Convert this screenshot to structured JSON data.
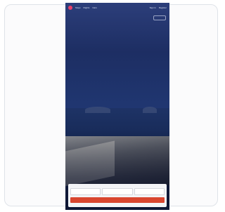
{
  "nav": {
    "links": [
      "Stays",
      "Flights",
      "Cars"
    ],
    "right": [
      "Sign in",
      "Register"
    ]
  },
  "hero": {
    "headline": "",
    "subline": ""
  },
  "search": {
    "title": "",
    "fields": [
      {
        "label": "",
        "value": ""
      },
      {
        "label": "",
        "value": ""
      },
      {
        "label": "",
        "value": ""
      }
    ],
    "cta_label": ""
  },
  "colors": {
    "brand": "#e8416a",
    "cta": "#d9462f",
    "sky": "#1d2e63"
  }
}
